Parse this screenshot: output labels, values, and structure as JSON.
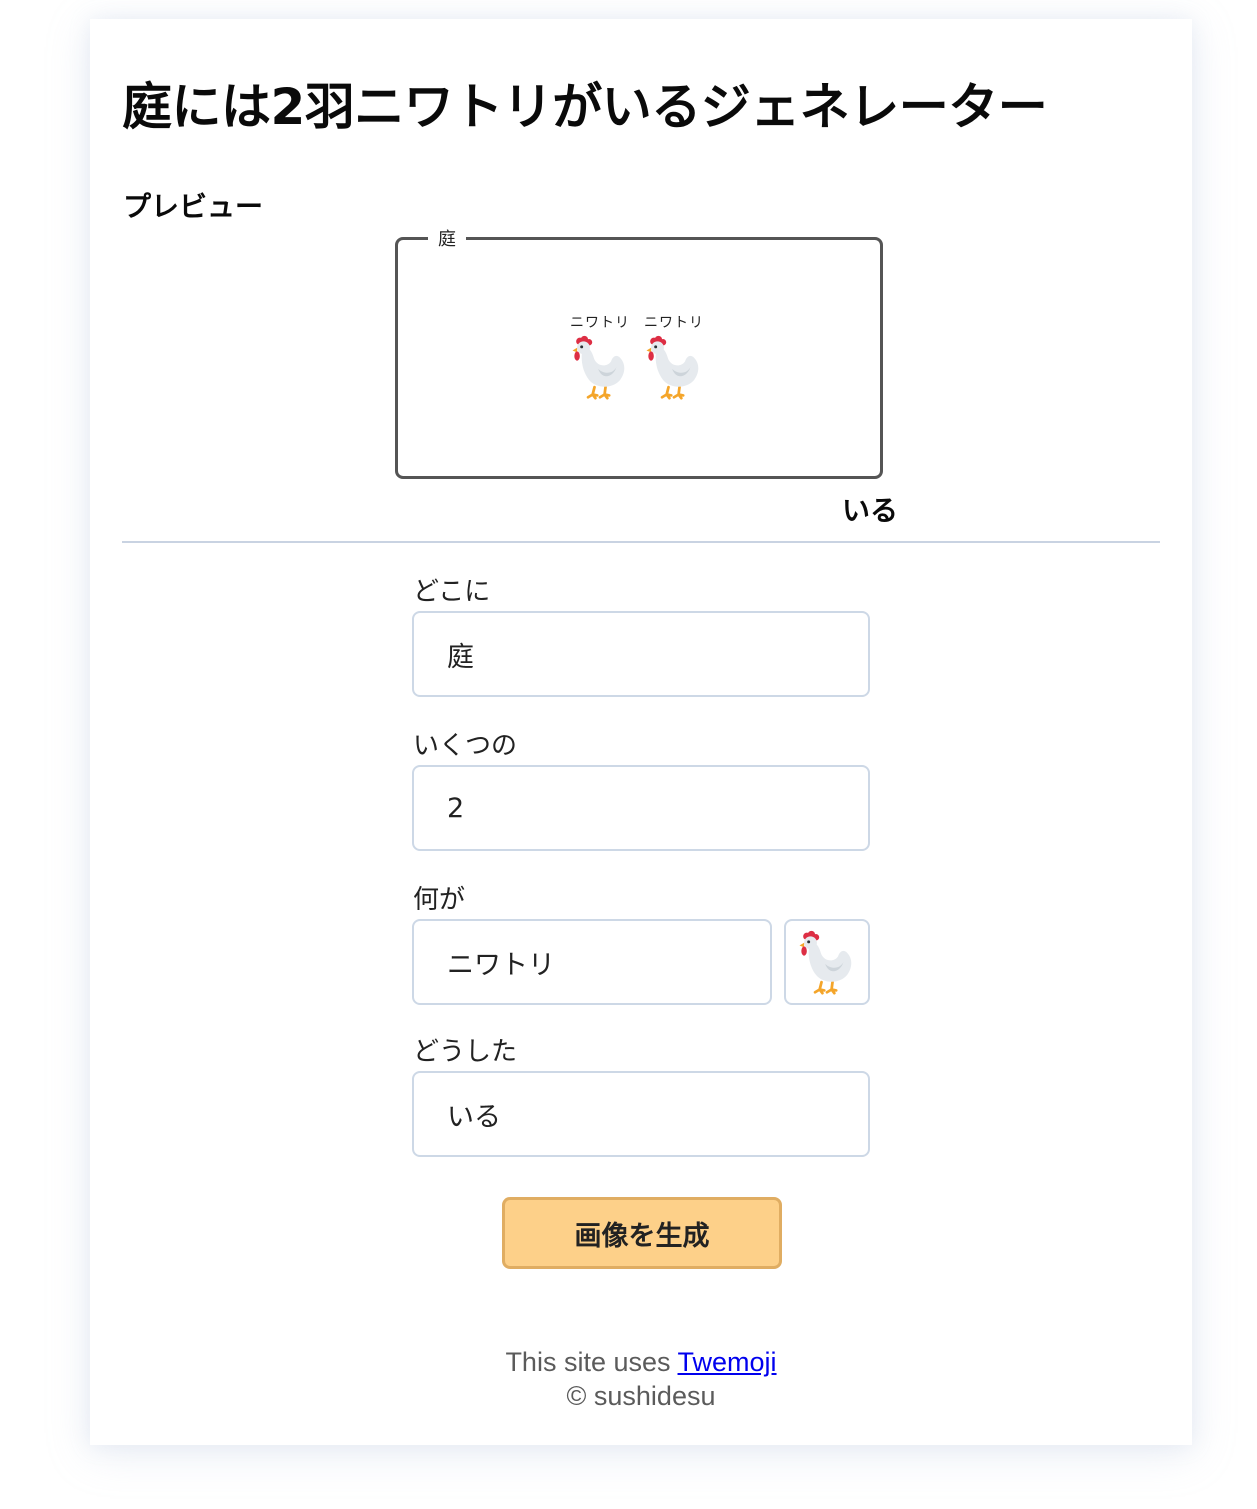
{
  "header": {
    "title": "庭には2羽ニワトリがいるジェネレーター"
  },
  "preview": {
    "heading": "プレビュー",
    "place": "庭",
    "chickens": [
      {
        "name": "ニワトリ",
        "icon": "chicken-icon"
      },
      {
        "name": "ニワトリ",
        "icon": "chicken-icon"
      }
    ],
    "verb": "いる"
  },
  "form": {
    "where_label": "どこに",
    "where_value": "庭",
    "count_label": "いくつの",
    "count_value": "2",
    "what_label": "何が",
    "what_value": "ニワトリ",
    "what_emoji_icon": "chicken-icon",
    "action_label": "どうした",
    "action_value": "いる",
    "generate_label": "画像を生成"
  },
  "footer": {
    "uses_prefix": "This site uses ",
    "twemoji_link": "Twemoji",
    "copyright": "© sushidesu"
  },
  "colors": {
    "accent_button": "#fdd089",
    "accent_button_border": "#e0ad62",
    "input_border": "#cdd8e6",
    "link": "#0000ee"
  }
}
